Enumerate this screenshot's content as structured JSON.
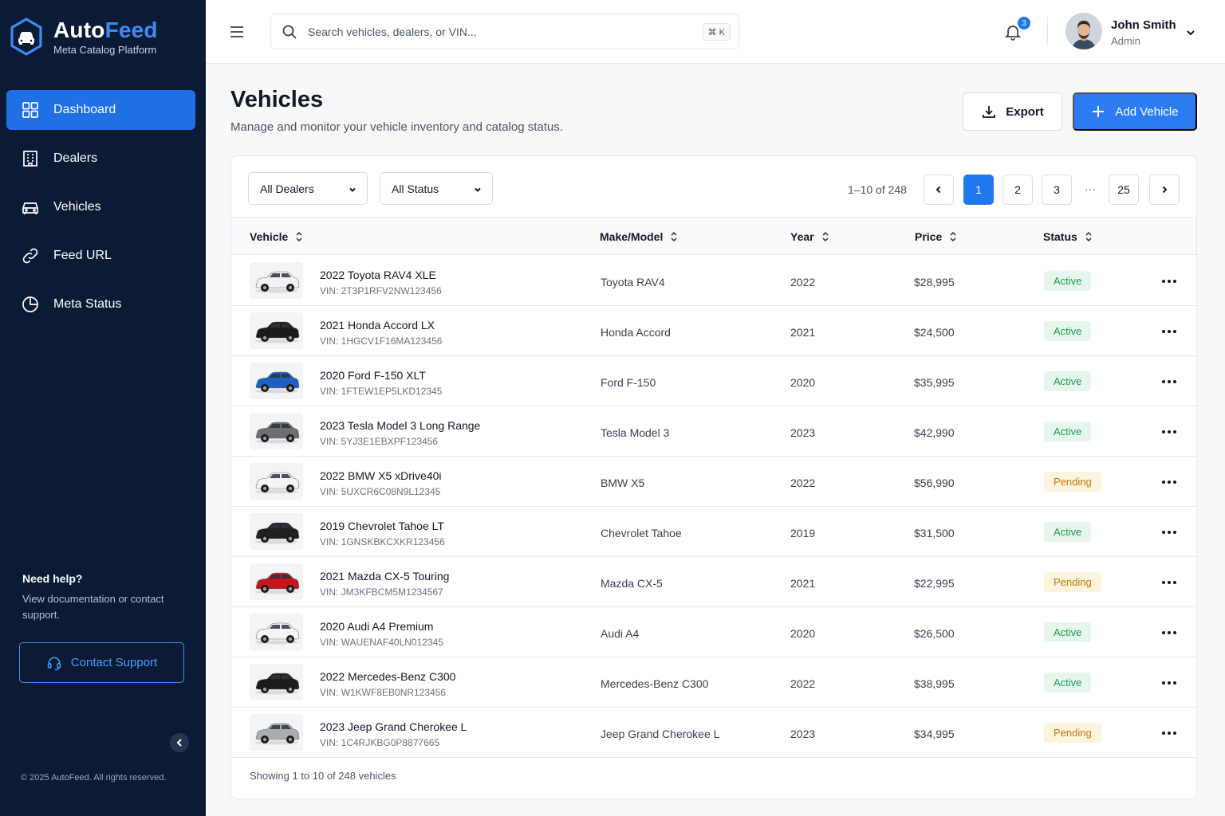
{
  "brand": {
    "name_part1": "Auto",
    "name_part2": "Feed",
    "subtitle": "Meta Catalog Platform",
    "accent": "#3b8cf5"
  },
  "sidebar": {
    "items": [
      {
        "label": "Dashboard",
        "icon": "grid-icon",
        "active": true
      },
      {
        "label": "Dealers",
        "icon": "building-icon",
        "active": false
      },
      {
        "label": "Vehicles",
        "icon": "car-icon",
        "active": false
      },
      {
        "label": "Feed URL",
        "icon": "link-icon",
        "active": false
      },
      {
        "label": "Meta Status",
        "icon": "pie-chart-icon",
        "active": false
      }
    ],
    "help_title": "Need help?",
    "help_text": "View documentation or contact support.",
    "support_label": "Contact Support",
    "copyright": "© 2025 AutoFeed. All rights reserved."
  },
  "topbar": {
    "search_placeholder": "Search vehicles, dealers, or VIN...",
    "shortcut": "⌘ K",
    "notification_count": "3",
    "user_name": "John Smith",
    "user_role": "Admin"
  },
  "page": {
    "title": "Vehicles",
    "subtitle": "Manage and monitor your vehicle inventory and catalog status.",
    "export_label": "Export",
    "add_label": "Add Vehicle"
  },
  "filters": {
    "dealers": "All Dealers",
    "status": "All Status"
  },
  "pagination": {
    "range": "1–10 of 248",
    "pages": [
      "1",
      "2",
      "3",
      "25"
    ],
    "ellipsis": "···",
    "current": "1"
  },
  "table": {
    "columns": [
      "Vehicle",
      "Make/Model",
      "Year",
      "Price",
      "Status"
    ],
    "rows": [
      {
        "name": "2022 Toyota RAV4 XLE",
        "vin": "VIN: 2T3P1RFV2NW123456",
        "make": "Toyota RAV4",
        "year": "2022",
        "price": "$28,995",
        "status": "Active",
        "car_color": "#f2f2f2"
      },
      {
        "name": "2021 Honda Accord LX",
        "vin": "VIN: 1HGCV1F16MA123456",
        "make": "Honda Accord",
        "year": "2021",
        "price": "$24,500",
        "status": "Active",
        "car_color": "#1b1b1b"
      },
      {
        "name": "2020 Ford F-150 XLT",
        "vin": "VIN: 1FTEW1EP5LKD12345",
        "make": "Ford F-150",
        "year": "2020",
        "price": "$35,995",
        "status": "Active",
        "car_color": "#1f5fbf"
      },
      {
        "name": "2023 Tesla Model 3 Long Range",
        "vin": "VIN: 5YJ3E1EBXPF123456",
        "make": "Tesla Model 3",
        "year": "2023",
        "price": "$42,990",
        "status": "Active",
        "car_color": "#6b6e73"
      },
      {
        "name": "2022 BMW X5 xDrive40i",
        "vin": "VIN: 5UXCR6C08N9L12345",
        "make": "BMW X5",
        "year": "2022",
        "price": "$56,990",
        "status": "Pending",
        "car_color": "#f4f4f4"
      },
      {
        "name": "2019 Chevrolet Tahoe LT",
        "vin": "VIN: 1GNSKBKCXKR123456",
        "make": "Chevrolet Tahoe",
        "year": "2019",
        "price": "$31,500",
        "status": "Active",
        "car_color": "#202020"
      },
      {
        "name": "2021 Mazda CX-5 Touring",
        "vin": "VIN: JM3KFBCM5M1234567",
        "make": "Mazda CX-5",
        "year": "2021",
        "price": "$22,995",
        "status": "Pending",
        "car_color": "#c4161c"
      },
      {
        "name": "2020 Audi A4 Premium",
        "vin": "VIN: WAUENAF40LN012345",
        "make": "Audi A4",
        "year": "2020",
        "price": "$26,500",
        "status": "Active",
        "car_color": "#f4f4f4"
      },
      {
        "name": "2022 Mercedes-Benz C300",
        "vin": "VIN: W1KWF8EB0NR123456",
        "make": "Mercedes-Benz C300",
        "year": "2022",
        "price": "$38,995",
        "status": "Active",
        "car_color": "#1c1c1c"
      },
      {
        "name": "2023 Jeep Grand Cherokee L",
        "vin": "VIN: 1C4RJKBG0P8877665",
        "make": "Jeep Grand Cherokee L",
        "year": "2023",
        "price": "$34,995",
        "status": "Pending",
        "car_color": "#a9acb0"
      }
    ],
    "footer": "Showing 1 to 10 of 248 vehicles"
  }
}
